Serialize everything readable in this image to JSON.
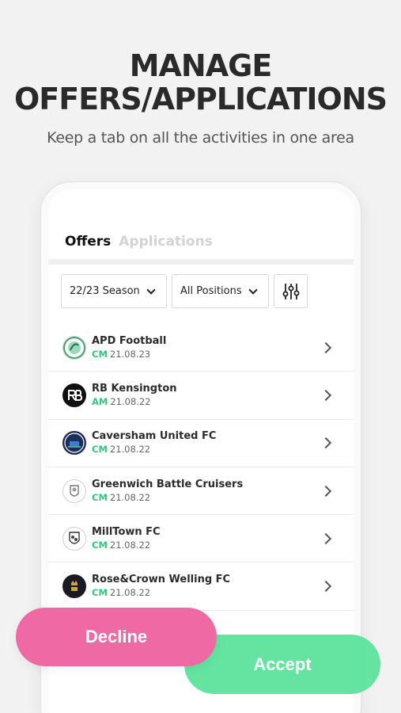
{
  "headline": {
    "line1": "MANAGE",
    "line2": "OFFERS/APPLICATIONS"
  },
  "subhead": "Keep a tab on all the activities in one area",
  "tabs": [
    {
      "label": "Offers",
      "active": true
    },
    {
      "label": "Applications",
      "active": false
    }
  ],
  "filters": {
    "season": "22/23 Season",
    "positions": "All Positions",
    "settings_icon": "sliders-icon"
  },
  "offers": [
    {
      "club": "APD Football",
      "position": "CM",
      "date": "21.08.23",
      "logo": "apd-football-logo"
    },
    {
      "club": "RB Kensington",
      "position": "AM",
      "date": "21.08.22",
      "logo": "rb-kensington-logo"
    },
    {
      "club": "Caversham United FC",
      "position": "CM",
      "date": "21.08.22",
      "logo": "caversham-logo"
    },
    {
      "club": "Greenwich Battle Cruisers",
      "position": "CM",
      "date": "21.08.22",
      "logo": "greenwich-logo"
    },
    {
      "club": "MillTown FC",
      "position": "CM",
      "date": "21.08.22",
      "logo": "milltown-logo"
    },
    {
      "club": "Rose&Crown Welling FC",
      "position": "CM",
      "date": "21.08.22",
      "logo": "rose-crown-logo"
    }
  ],
  "actions": {
    "decline": "Decline",
    "accept": "Accept"
  },
  "colors": {
    "accent_green": "#34c77b",
    "decline_pink": "#ef6aa5",
    "accept_green": "#5de39d"
  }
}
